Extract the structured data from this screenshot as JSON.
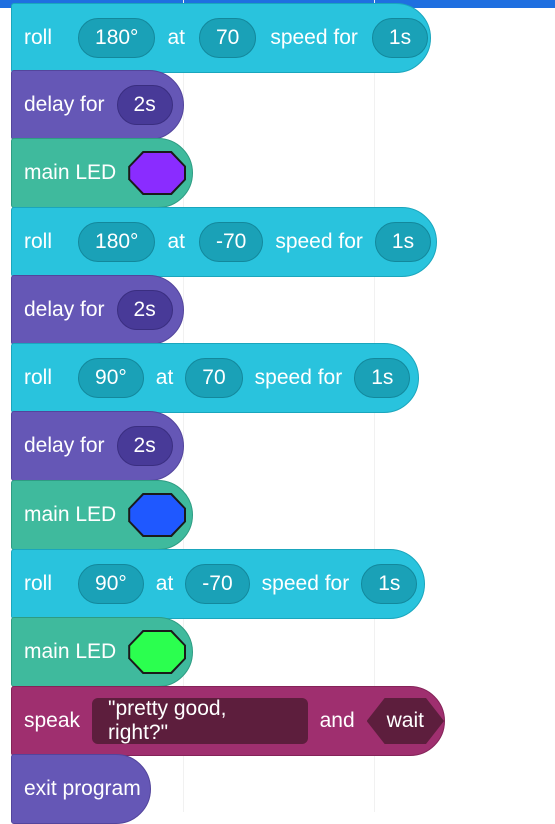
{
  "colors": {
    "roll": "#29c3dd",
    "delay": "#6557b6",
    "led": "#3fba9d",
    "speak": "#9f2f6f",
    "topbar": "#1f6fe0"
  },
  "blocks": {
    "roll1": {
      "label": "roll",
      "heading": "180°",
      "at_label": "at",
      "speed": "70",
      "speed_label": "speed for",
      "duration": "1s"
    },
    "delay1": {
      "label": "delay for",
      "duration": "2s"
    },
    "led1": {
      "label": "main LED",
      "color": "#8a2cff"
    },
    "roll2": {
      "label": "roll",
      "heading": "180°",
      "at_label": "at",
      "speed": "-70",
      "speed_label": "speed for",
      "duration": "1s"
    },
    "delay2": {
      "label": "delay for",
      "duration": "2s"
    },
    "roll3": {
      "label": "roll",
      "heading": "90°",
      "at_label": "at",
      "speed": "70",
      "speed_label": "speed for",
      "duration": "1s"
    },
    "delay3": {
      "label": "delay for",
      "duration": "2s"
    },
    "led2": {
      "label": "main LED",
      "color": "#1f58ff"
    },
    "roll4": {
      "label": "roll",
      "heading": "90°",
      "at_label": "at",
      "speed": "-70",
      "speed_label": "speed for",
      "duration": "1s"
    },
    "led3": {
      "label": "main LED",
      "color": "#2bff4f"
    },
    "speak": {
      "label": "speak",
      "text": "\"pretty good, right?\"",
      "and_label": "and",
      "wait": "wait"
    },
    "exit": {
      "label": "exit program"
    }
  }
}
